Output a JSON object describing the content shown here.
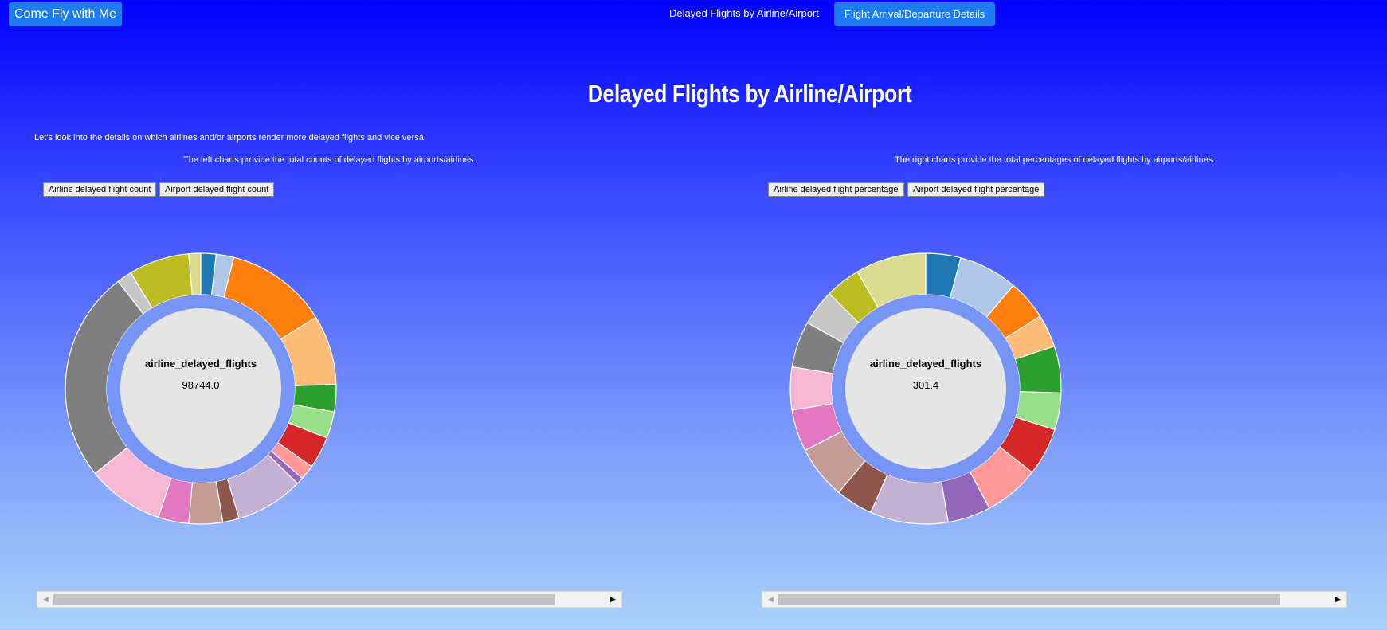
{
  "nav": {
    "brand": "Come Fly with Me",
    "link_delayed": "Delayed Flights by Airline/Airport",
    "link_details": "Flight Arrival/Departure Details"
  },
  "main": {
    "title": "Delayed Flights by Airline/Airport",
    "intro": "Let's look into the details on which airlines and/or airports render more delayed flights and vice versa",
    "left_subtitle": "The left charts provide the total counts of delayed flights by airports/airlines.",
    "right_subtitle": "The right charts provide the total percentages of delayed flights by airports/airlines.",
    "left_buttons": [
      "Airline delayed flight count",
      "Airport delayed flight count"
    ],
    "right_buttons": [
      "Airline delayed flight percentage",
      "Airport delayed flight percentage"
    ]
  },
  "chart_data": [
    {
      "type": "pie",
      "donut": true,
      "center_label": "airline_delayed_flights",
      "center_value": "98744.0",
      "slice_colors": [
        "#1f77b4",
        "#aec7e8",
        "#ff7f0e",
        "#ffbb78",
        "#2ca02c",
        "#98df8a",
        "#d62728",
        "#ff9896",
        "#9467bd",
        "#c5b0d5",
        "#8c564b",
        "#c49c94",
        "#e377c2",
        "#f7b6d2",
        "#7f7f7f",
        "#c7c7c7",
        "#bcbd22",
        "#dbdb8d"
      ],
      "values": [
        1737,
        2008,
        11640,
        7925,
        3084,
        3035,
        3622,
        1688,
        797,
        7681,
        1872,
        3837,
        3471,
        8722,
        24094,
        1705,
        6858,
        1360
      ]
    },
    {
      "type": "pie",
      "donut": true,
      "center_label": "airline_delayed_flights",
      "center_value": "301.4",
      "slice_colors": [
        "#1f77b4",
        "#aec7e8",
        "#ff7f0e",
        "#ffbb78",
        "#2ca02c",
        "#98df8a",
        "#d62728",
        "#ff9896",
        "#9467bd",
        "#c5b0d5",
        "#8c564b",
        "#c49c94",
        "#e377c2",
        "#f7b6d2",
        "#7f7f7f",
        "#c7c7c7",
        "#bcbd22",
        "#dbdb8d"
      ],
      "values": [
        12.6,
        21.2,
        14.5,
        11.8,
        16.8,
        13.3,
        17.2,
        19.9,
        15.5,
        28.1,
        13.4,
        19.2,
        15.1,
        15.4,
        16.6,
        12.9,
        12.7,
        25.4
      ]
    }
  ]
}
